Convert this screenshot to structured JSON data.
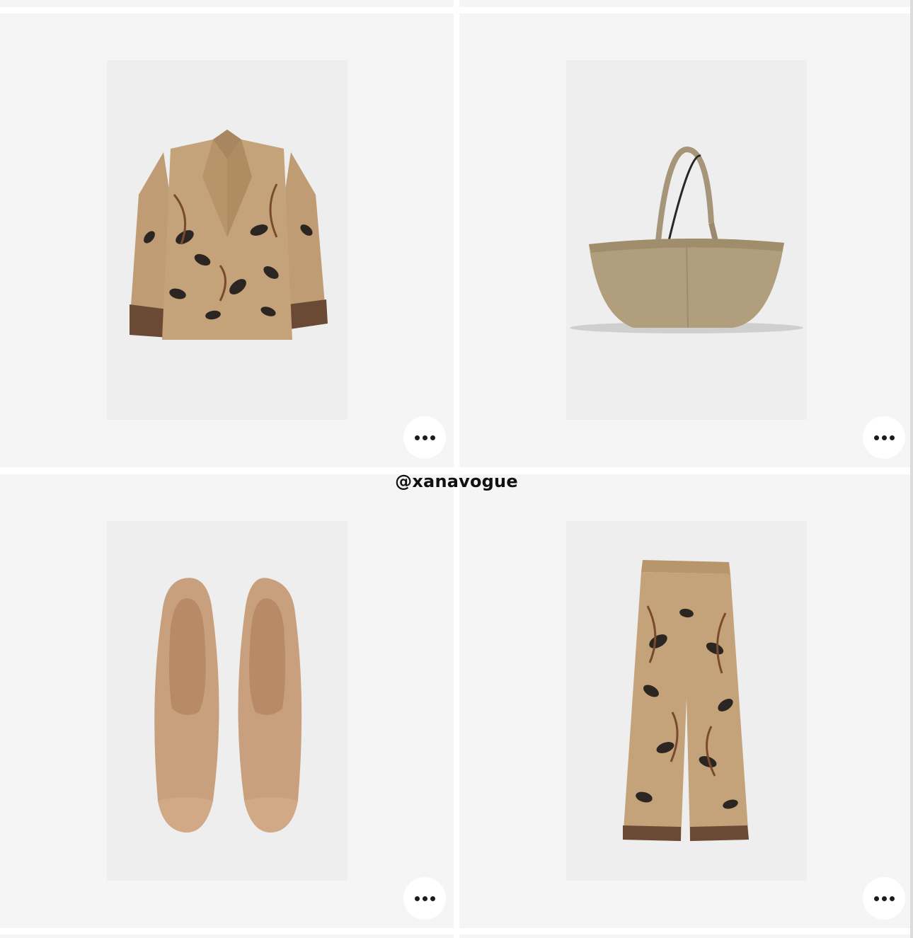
{
  "watermark": "@xanavogue",
  "products": [
    {
      "name": "printed-jacket",
      "more_icon": "ellipsis-icon"
    },
    {
      "name": "tote-bag",
      "more_icon": "ellipsis-icon"
    },
    {
      "name": "suede-ballet-flats",
      "more_icon": "ellipsis-icon"
    },
    {
      "name": "printed-wide-trousers",
      "more_icon": "ellipsis-icon"
    }
  ],
  "colors": {
    "cell_background": "#f5f5f6",
    "page_background": "#ffffff",
    "button_background": "#ffffff",
    "dot_color": "#1c1c1c",
    "jacket_base": "#c4a27a",
    "bag_base": "#b09e7c",
    "flats_base": "#c9a07e",
    "print_dark": "#2b2622"
  }
}
